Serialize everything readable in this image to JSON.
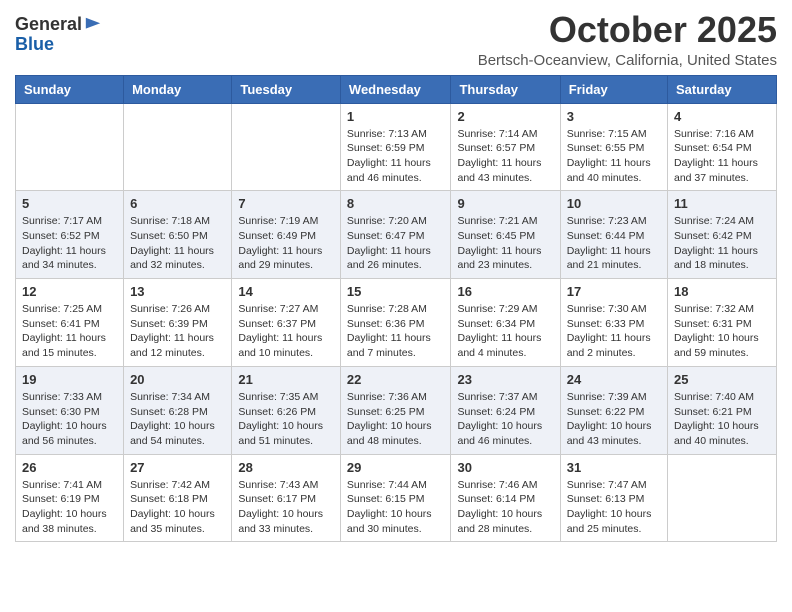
{
  "header": {
    "logo_general": "General",
    "logo_blue": "Blue",
    "month": "October 2025",
    "location": "Bertsch-Oceanview, California, United States"
  },
  "weekdays": [
    "Sunday",
    "Monday",
    "Tuesday",
    "Wednesday",
    "Thursday",
    "Friday",
    "Saturday"
  ],
  "weeks": [
    [
      {
        "day": "",
        "sunrise": "",
        "sunset": "",
        "daylight": ""
      },
      {
        "day": "",
        "sunrise": "",
        "sunset": "",
        "daylight": ""
      },
      {
        "day": "",
        "sunrise": "",
        "sunset": "",
        "daylight": ""
      },
      {
        "day": "1",
        "sunrise": "Sunrise: 7:13 AM",
        "sunset": "Sunset: 6:59 PM",
        "daylight": "Daylight: 11 hours and 46 minutes."
      },
      {
        "day": "2",
        "sunrise": "Sunrise: 7:14 AM",
        "sunset": "Sunset: 6:57 PM",
        "daylight": "Daylight: 11 hours and 43 minutes."
      },
      {
        "day": "3",
        "sunrise": "Sunrise: 7:15 AM",
        "sunset": "Sunset: 6:55 PM",
        "daylight": "Daylight: 11 hours and 40 minutes."
      },
      {
        "day": "4",
        "sunrise": "Sunrise: 7:16 AM",
        "sunset": "Sunset: 6:54 PM",
        "daylight": "Daylight: 11 hours and 37 minutes."
      }
    ],
    [
      {
        "day": "5",
        "sunrise": "Sunrise: 7:17 AM",
        "sunset": "Sunset: 6:52 PM",
        "daylight": "Daylight: 11 hours and 34 minutes."
      },
      {
        "day": "6",
        "sunrise": "Sunrise: 7:18 AM",
        "sunset": "Sunset: 6:50 PM",
        "daylight": "Daylight: 11 hours and 32 minutes."
      },
      {
        "day": "7",
        "sunrise": "Sunrise: 7:19 AM",
        "sunset": "Sunset: 6:49 PM",
        "daylight": "Daylight: 11 hours and 29 minutes."
      },
      {
        "day": "8",
        "sunrise": "Sunrise: 7:20 AM",
        "sunset": "Sunset: 6:47 PM",
        "daylight": "Daylight: 11 hours and 26 minutes."
      },
      {
        "day": "9",
        "sunrise": "Sunrise: 7:21 AM",
        "sunset": "Sunset: 6:45 PM",
        "daylight": "Daylight: 11 hours and 23 minutes."
      },
      {
        "day": "10",
        "sunrise": "Sunrise: 7:23 AM",
        "sunset": "Sunset: 6:44 PM",
        "daylight": "Daylight: 11 hours and 21 minutes."
      },
      {
        "day": "11",
        "sunrise": "Sunrise: 7:24 AM",
        "sunset": "Sunset: 6:42 PM",
        "daylight": "Daylight: 11 hours and 18 minutes."
      }
    ],
    [
      {
        "day": "12",
        "sunrise": "Sunrise: 7:25 AM",
        "sunset": "Sunset: 6:41 PM",
        "daylight": "Daylight: 11 hours and 15 minutes."
      },
      {
        "day": "13",
        "sunrise": "Sunrise: 7:26 AM",
        "sunset": "Sunset: 6:39 PM",
        "daylight": "Daylight: 11 hours and 12 minutes."
      },
      {
        "day": "14",
        "sunrise": "Sunrise: 7:27 AM",
        "sunset": "Sunset: 6:37 PM",
        "daylight": "Daylight: 11 hours and 10 minutes."
      },
      {
        "day": "15",
        "sunrise": "Sunrise: 7:28 AM",
        "sunset": "Sunset: 6:36 PM",
        "daylight": "Daylight: 11 hours and 7 minutes."
      },
      {
        "day": "16",
        "sunrise": "Sunrise: 7:29 AM",
        "sunset": "Sunset: 6:34 PM",
        "daylight": "Daylight: 11 hours and 4 minutes."
      },
      {
        "day": "17",
        "sunrise": "Sunrise: 7:30 AM",
        "sunset": "Sunset: 6:33 PM",
        "daylight": "Daylight: 11 hours and 2 minutes."
      },
      {
        "day": "18",
        "sunrise": "Sunrise: 7:32 AM",
        "sunset": "Sunset: 6:31 PM",
        "daylight": "Daylight: 10 hours and 59 minutes."
      }
    ],
    [
      {
        "day": "19",
        "sunrise": "Sunrise: 7:33 AM",
        "sunset": "Sunset: 6:30 PM",
        "daylight": "Daylight: 10 hours and 56 minutes."
      },
      {
        "day": "20",
        "sunrise": "Sunrise: 7:34 AM",
        "sunset": "Sunset: 6:28 PM",
        "daylight": "Daylight: 10 hours and 54 minutes."
      },
      {
        "day": "21",
        "sunrise": "Sunrise: 7:35 AM",
        "sunset": "Sunset: 6:26 PM",
        "daylight": "Daylight: 10 hours and 51 minutes."
      },
      {
        "day": "22",
        "sunrise": "Sunrise: 7:36 AM",
        "sunset": "Sunset: 6:25 PM",
        "daylight": "Daylight: 10 hours and 48 minutes."
      },
      {
        "day": "23",
        "sunrise": "Sunrise: 7:37 AM",
        "sunset": "Sunset: 6:24 PM",
        "daylight": "Daylight: 10 hours and 46 minutes."
      },
      {
        "day": "24",
        "sunrise": "Sunrise: 7:39 AM",
        "sunset": "Sunset: 6:22 PM",
        "daylight": "Daylight: 10 hours and 43 minutes."
      },
      {
        "day": "25",
        "sunrise": "Sunrise: 7:40 AM",
        "sunset": "Sunset: 6:21 PM",
        "daylight": "Daylight: 10 hours and 40 minutes."
      }
    ],
    [
      {
        "day": "26",
        "sunrise": "Sunrise: 7:41 AM",
        "sunset": "Sunset: 6:19 PM",
        "daylight": "Daylight: 10 hours and 38 minutes."
      },
      {
        "day": "27",
        "sunrise": "Sunrise: 7:42 AM",
        "sunset": "Sunset: 6:18 PM",
        "daylight": "Daylight: 10 hours and 35 minutes."
      },
      {
        "day": "28",
        "sunrise": "Sunrise: 7:43 AM",
        "sunset": "Sunset: 6:17 PM",
        "daylight": "Daylight: 10 hours and 33 minutes."
      },
      {
        "day": "29",
        "sunrise": "Sunrise: 7:44 AM",
        "sunset": "Sunset: 6:15 PM",
        "daylight": "Daylight: 10 hours and 30 minutes."
      },
      {
        "day": "30",
        "sunrise": "Sunrise: 7:46 AM",
        "sunset": "Sunset: 6:14 PM",
        "daylight": "Daylight: 10 hours and 28 minutes."
      },
      {
        "day": "31",
        "sunrise": "Sunrise: 7:47 AM",
        "sunset": "Sunset: 6:13 PM",
        "daylight": "Daylight: 10 hours and 25 minutes."
      },
      {
        "day": "",
        "sunrise": "",
        "sunset": "",
        "daylight": ""
      }
    ]
  ]
}
